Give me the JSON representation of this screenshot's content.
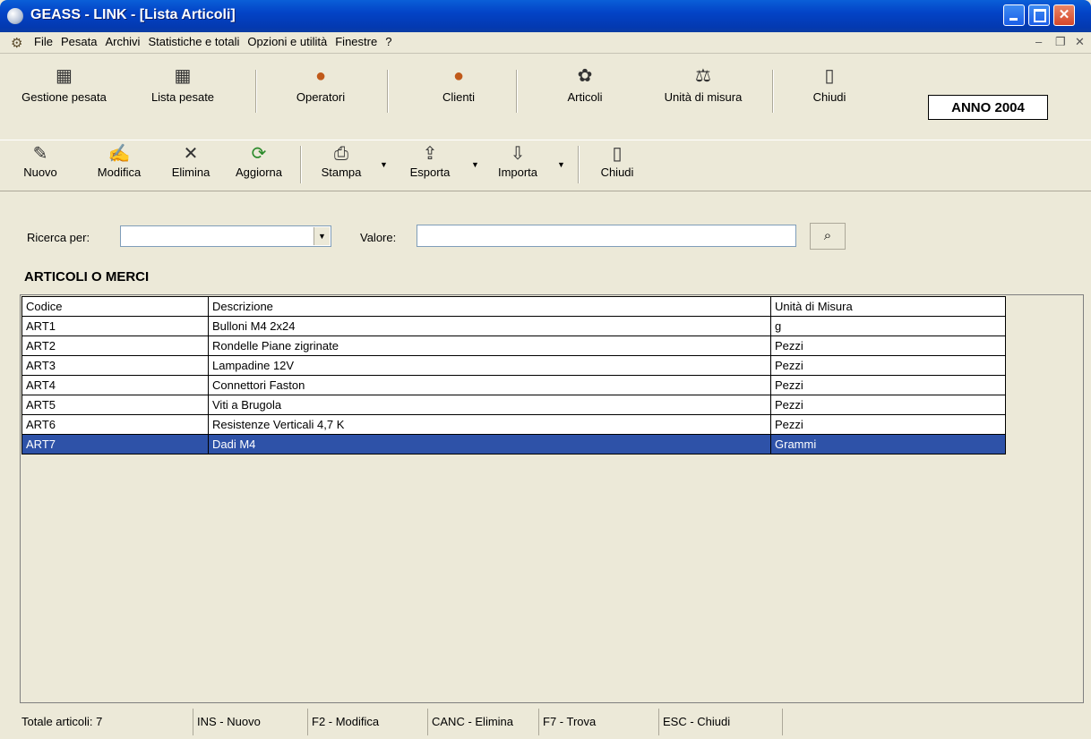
{
  "window": {
    "title": "GEASS - LINK - [Lista Articoli]"
  },
  "menu": [
    "File",
    "Pesata",
    "Archivi",
    "Statistiche e totali",
    "Opzioni e utilità",
    "Finestre",
    "?"
  ],
  "toolbar1": {
    "buttons": [
      {
        "label": "Gestione pesata",
        "icon": "grid-icon"
      },
      {
        "label": "Lista pesate",
        "icon": "grid-list-icon"
      },
      {
        "label": "Operatori",
        "icon": "operator-icon"
      },
      {
        "label": "Clienti",
        "icon": "client-icon"
      },
      {
        "label": "Articoli",
        "icon": "article-icon"
      },
      {
        "label": "Unità di misura",
        "icon": "scale-icon"
      },
      {
        "label": "Chiudi",
        "icon": "exit-door-icon"
      }
    ],
    "year_label": "ANNO 2004"
  },
  "toolbar2": {
    "buttons": [
      {
        "label": "Nuovo",
        "icon": "new-document-icon"
      },
      {
        "label": "Modifica",
        "icon": "edit-icon"
      },
      {
        "label": "Elimina",
        "icon": "delete-icon"
      },
      {
        "label": "Aggiorna",
        "icon": "refresh-icon"
      },
      {
        "label": "Stampa",
        "icon": "printer-icon"
      },
      {
        "label": "Esporta",
        "icon": "export-icon"
      },
      {
        "label": "Importa",
        "icon": "import-icon"
      },
      {
        "label": "Chiudi",
        "icon": "exit-door-icon"
      }
    ]
  },
  "search": {
    "field_label": "Ricerca per:",
    "field_value": "",
    "value_label": "Valore:",
    "value": ""
  },
  "section_title": "ARTICOLI O MERCI",
  "table": {
    "columns": [
      "Codice",
      "Descrizione",
      "Unità di Misura"
    ],
    "rows": [
      [
        "ART1",
        "Bulloni M4 2x24",
        "g"
      ],
      [
        "ART2",
        "Rondelle Piane zigrinate",
        "Pezzi"
      ],
      [
        "ART3",
        "Lampadine 12V",
        "Pezzi"
      ],
      [
        "ART4",
        "Connettori Faston",
        "Pezzi"
      ],
      [
        "ART5",
        "Viti a Brugola",
        "Pezzi"
      ],
      [
        "ART6",
        "Resistenze Verticali 4,7 K",
        "Pezzi"
      ],
      [
        "ART7",
        "Dadi M4",
        "Grammi"
      ]
    ],
    "selected_row": 6
  },
  "statusbar": [
    "Totale articoli: 7",
    "INS - Nuovo",
    "F2 - Modifica",
    "CANC - Elimina",
    "F7 - Trova",
    "ESC - Chiudi",
    ""
  ],
  "colors": {
    "titlebar": "#0343c6",
    "selection": "#2e52a8",
    "chrome": "#ece9d8"
  }
}
